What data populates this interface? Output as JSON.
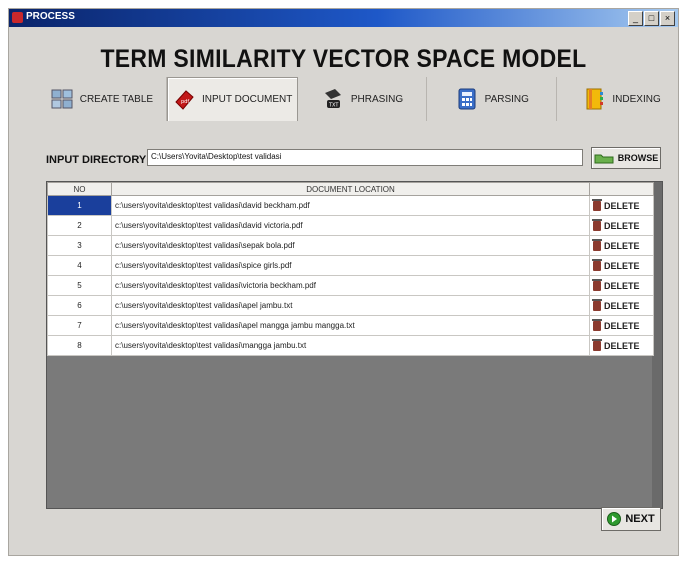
{
  "window": {
    "title": "PROCESS",
    "controls": [
      "_",
      "□",
      "×"
    ]
  },
  "heading": "TERM SIMILARITY VECTOR SPACE MODEL",
  "tabs": [
    {
      "label": "CREATE TABLE",
      "icon": "table-icon",
      "active": false
    },
    {
      "label": "INPUT DOCUMENT",
      "icon": "pdf-document-icon",
      "active": true
    },
    {
      "label": "PHRASING",
      "icon": "text-file-icon",
      "active": false
    },
    {
      "label": "PARSING",
      "icon": "calculator-icon",
      "active": false
    },
    {
      "label": "INDEXING",
      "icon": "index-book-icon",
      "active": false
    }
  ],
  "input_directory": {
    "label": "INPUT DIRECTORY",
    "value": "C:\\Users\\Yovita\\Desktop\\test validasi"
  },
  "browse_button": "BROWSE",
  "table": {
    "headers": [
      "NO",
      "DOCUMENT LOCATION",
      ""
    ],
    "delete_label": "DELETE",
    "rows": [
      {
        "no": "1",
        "location": "c:\\users\\yovita\\desktop\\test validasi\\david beckham.pdf",
        "selected": true
      },
      {
        "no": "2",
        "location": "c:\\users\\yovita\\desktop\\test validasi\\david victoria.pdf"
      },
      {
        "no": "3",
        "location": "c:\\users\\yovita\\desktop\\test validasi\\sepak bola.pdf"
      },
      {
        "no": "4",
        "location": "c:\\users\\yovita\\desktop\\test validasi\\spice girls.pdf"
      },
      {
        "no": "5",
        "location": "c:\\users\\yovita\\desktop\\test validasi\\victoria beckham.pdf"
      },
      {
        "no": "6",
        "location": "c:\\users\\yovita\\desktop\\test validasi\\apel jambu.txt"
      },
      {
        "no": "7",
        "location": "c:\\users\\yovita\\desktop\\test validasi\\apel mangga jambu mangga.txt"
      },
      {
        "no": "8",
        "location": "c:\\users\\yovita\\desktop\\test validasi\\mangga jambu.txt"
      }
    ]
  },
  "next_button": "NEXT",
  "colors": {
    "titlebar": "#0a246a",
    "selected_row": "#1a3f9c",
    "delete_icon": "#8b3a2e",
    "next_icon": "#2f9a2f"
  }
}
